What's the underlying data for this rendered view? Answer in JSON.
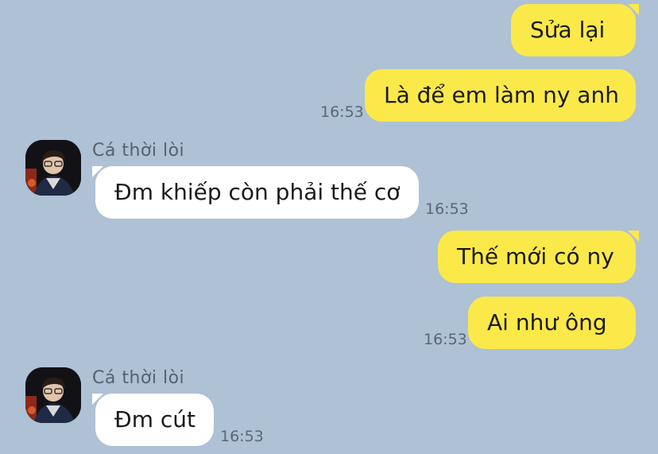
{
  "messages": [
    {
      "side": "out",
      "text": "Sửa lại"
    },
    {
      "side": "out",
      "text": "Là để em làm ny anh",
      "time": "16:53"
    },
    {
      "side": "in",
      "sender": "Cá thời lòi",
      "text": "Đm khiếp còn phải thế cơ",
      "time": "16:53"
    },
    {
      "side": "out",
      "text": "Thế mới có ny"
    },
    {
      "side": "out",
      "text": "Ai như ông",
      "time": "16:53"
    },
    {
      "side": "in",
      "sender": "Cá thời lòi",
      "text": "Đm cút",
      "time": "16:53"
    }
  ],
  "colors": {
    "background": "#aec1d5",
    "outgoing_bubble": "#fbe94a",
    "incoming_bubble": "#ffffff"
  },
  "icons": {
    "avatar": "profile-avatar"
  }
}
